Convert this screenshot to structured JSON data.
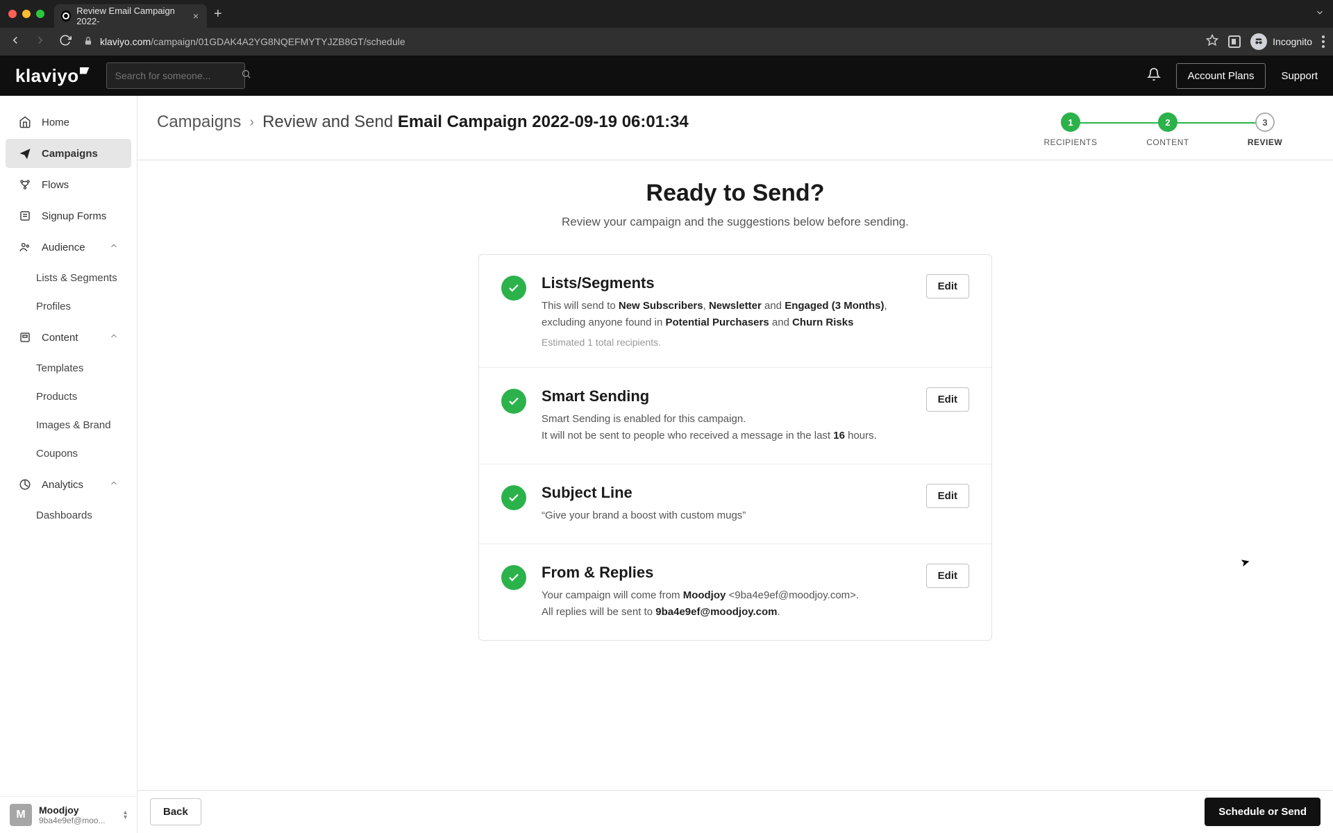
{
  "browser": {
    "tab_title": "Review Email Campaign 2022-",
    "url_domain": "klaviyo.com",
    "url_path": "/campaign/01GDAK4A2YG8NQEFMYTYJZB8GT/schedule",
    "incognito_label": "Incognito"
  },
  "header": {
    "logo_text": "klaviyo",
    "search_placeholder": "Search for someone...",
    "account_plans": "Account Plans",
    "support": "Support"
  },
  "sidebar": {
    "items": [
      {
        "label": "Home",
        "icon": "home"
      },
      {
        "label": "Campaigns",
        "icon": "send",
        "active": true
      },
      {
        "label": "Flows",
        "icon": "flow"
      },
      {
        "label": "Signup Forms",
        "icon": "form"
      },
      {
        "label": "Audience",
        "icon": "audience",
        "expandable": true
      },
      {
        "label": "Content",
        "icon": "content",
        "expandable": true
      },
      {
        "label": "Analytics",
        "icon": "analytics",
        "expandable": true
      }
    ],
    "audience_children": [
      "Lists & Segments",
      "Profiles"
    ],
    "content_children": [
      "Templates",
      "Products",
      "Images & Brand",
      "Coupons"
    ],
    "analytics_children": [
      "Dashboards"
    ],
    "workspace": {
      "avatar_letter": "M",
      "name": "Moodjoy",
      "email": "9ba4e9ef@moo..."
    }
  },
  "breadcrumb": {
    "root": "Campaigns",
    "prefix": "Review and Send",
    "title": "Email Campaign 2022-09-19 06:01:34"
  },
  "steps": [
    {
      "num": "1",
      "label": "RECIPIENTS",
      "state": "done"
    },
    {
      "num": "2",
      "label": "CONTENT",
      "state": "done"
    },
    {
      "num": "3",
      "label": "REVIEW",
      "state": "current"
    }
  ],
  "review": {
    "title": "Ready to Send?",
    "subtitle": "Review your campaign and the suggestions below before sending.",
    "cards": {
      "lists": {
        "title": "Lists/Segments",
        "pre1": "This will send to ",
        "b1": "New Subscribers",
        "sep1": ", ",
        "b2": "Newsletter",
        "mid1": " and ",
        "b3": "Engaged (3 Months)",
        "mid2": ", excluding anyone found in ",
        "b4": "Potential Purchasers",
        "mid3": " and ",
        "b5": "Churn Risks",
        "meta": "Estimated 1 total recipients.",
        "edit": "Edit"
      },
      "smart": {
        "title": "Smart Sending",
        "line1": "Smart Sending is enabled for this campaign.",
        "line2a": "It will not be sent to people who received a message in the last ",
        "line2b": "16",
        "line2c": " hours.",
        "edit": "Edit"
      },
      "subject": {
        "title": "Subject Line",
        "quote": "“Give your brand a boost with custom mugs”",
        "edit": "Edit"
      },
      "from": {
        "title": "From & Replies",
        "line1a": "Your campaign will come from ",
        "line1b": "Moodjoy",
        "line1c": " <9ba4e9ef@moodjoy.com>.",
        "line2a": "All replies will be sent to ",
        "line2b": "9ba4e9ef@moodjoy.com",
        "line2c": ".",
        "edit": "Edit"
      }
    }
  },
  "footer": {
    "back": "Back",
    "schedule": "Schedule or Send"
  }
}
